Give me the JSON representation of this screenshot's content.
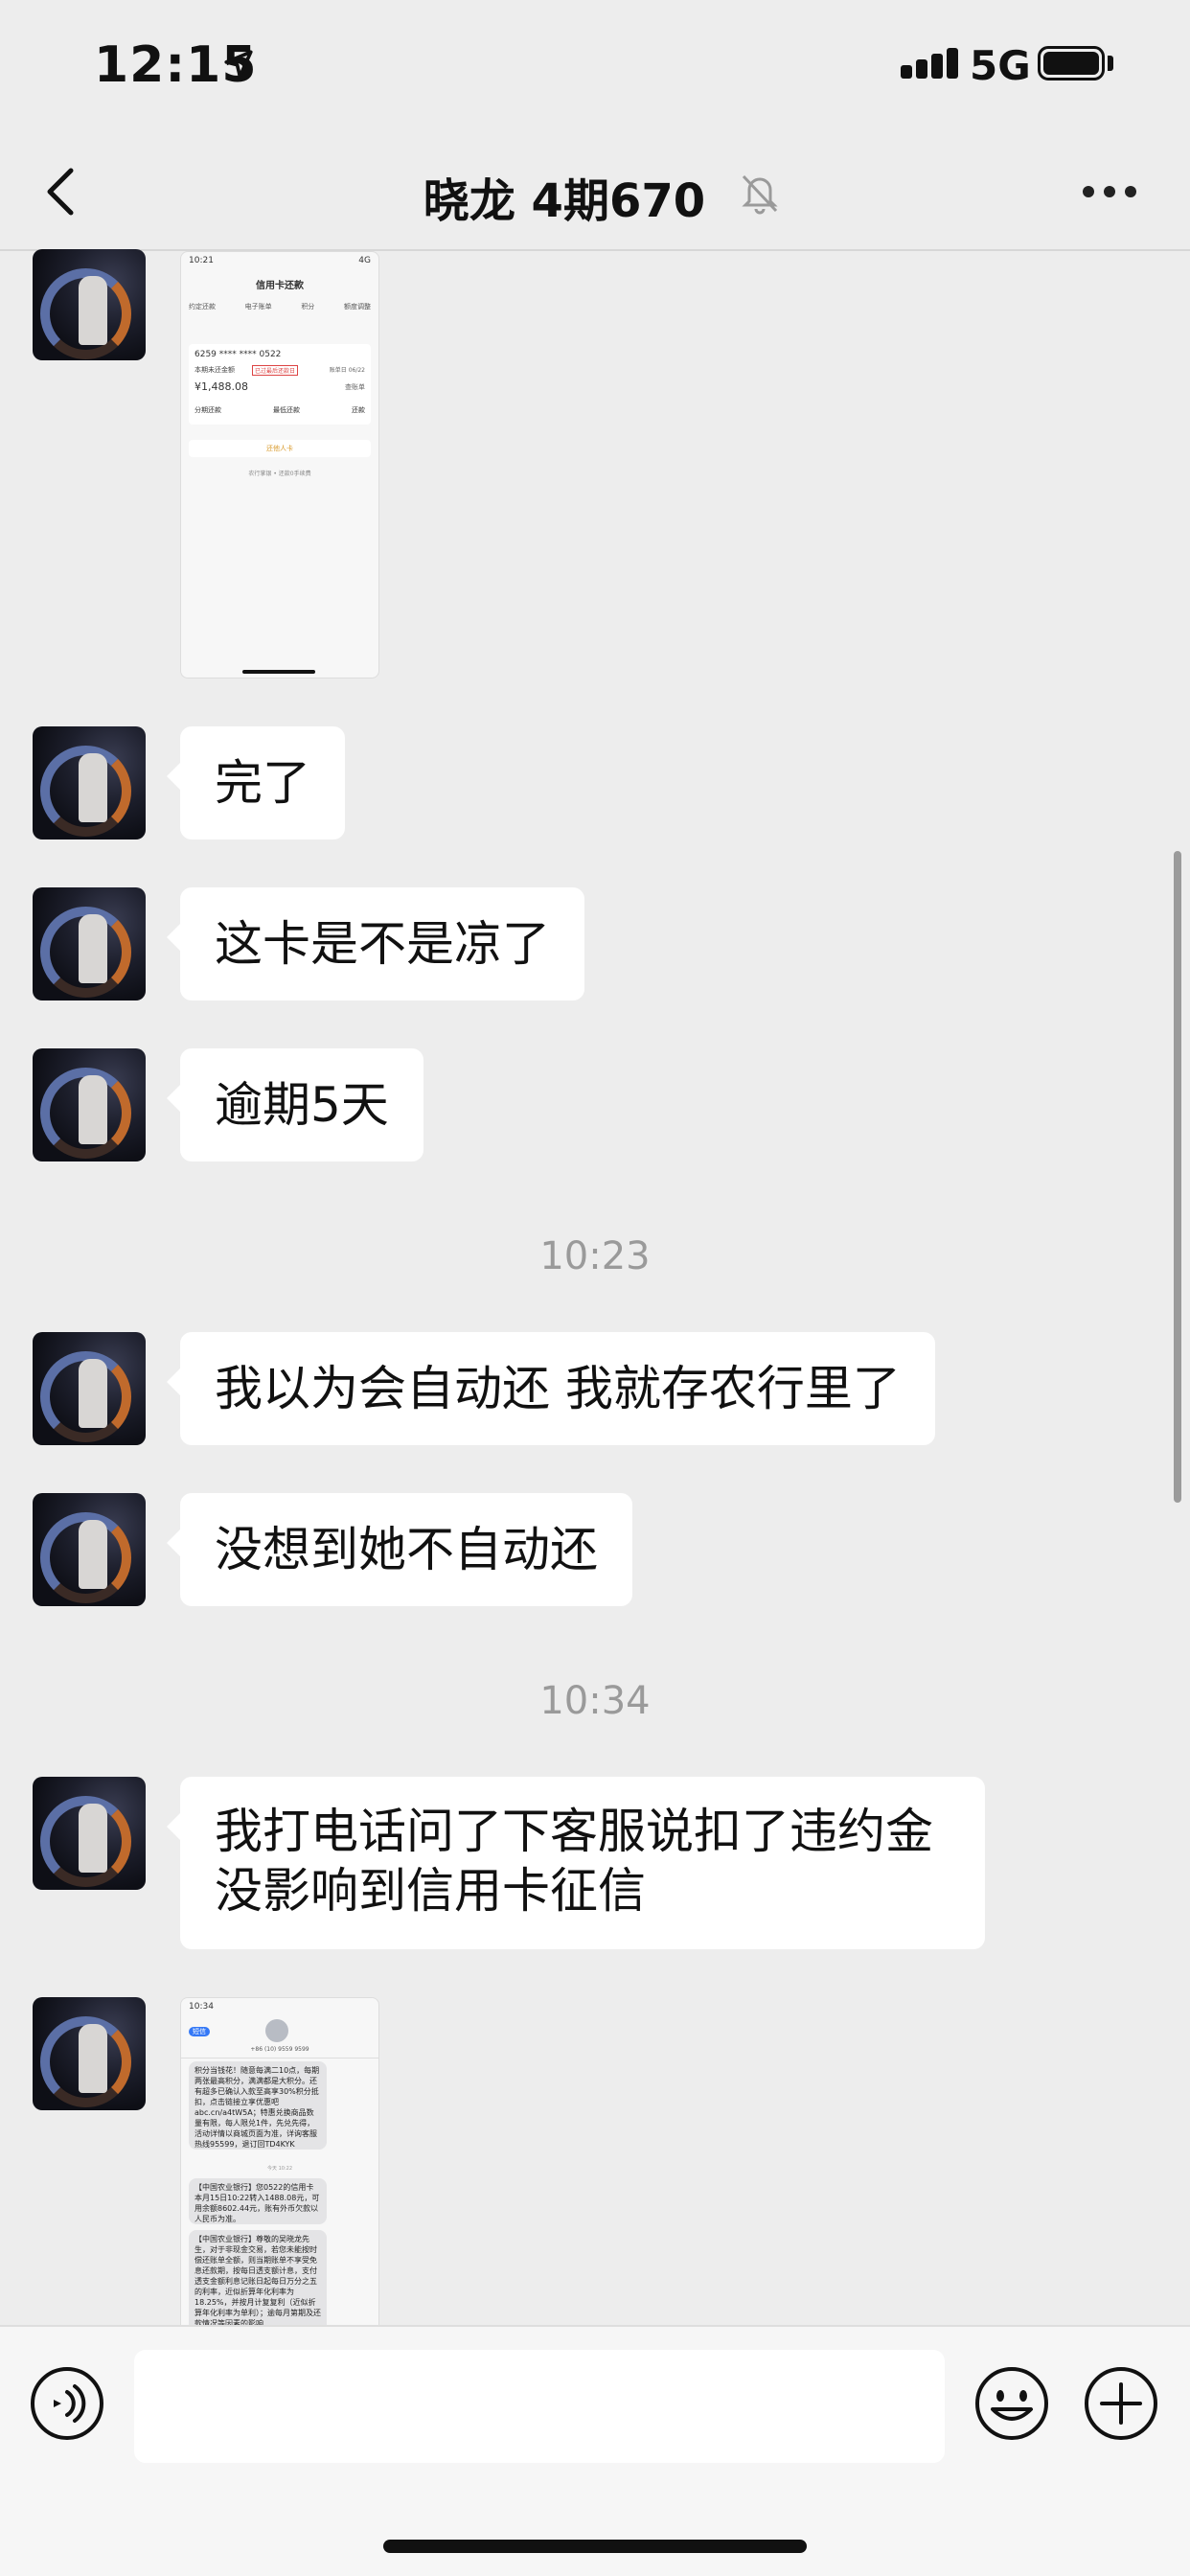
{
  "status_bar": {
    "time": "12:15",
    "network": "5G",
    "location_icon": "location-arrow-icon",
    "battery": "full"
  },
  "nav": {
    "title": "晓龙 4期670",
    "back_icon": "chevron-left-icon",
    "mute_icon": "bell-slash-icon",
    "more_icon": "ellipsis-icon"
  },
  "shot1": {
    "time": "10:21",
    "signal": "4G",
    "title": "信用卡还款",
    "tabs": [
      "约定还款",
      "电子账单",
      "积分",
      "额度调整"
    ],
    "card_number": "6259 **** **** 0522",
    "due_label": "本期未还金额",
    "due_tag": "已过最后还款日",
    "bill_date": "账单日 06/22",
    "amount": "¥1,488.08",
    "detail_link": "查账单",
    "actions": [
      "分期还款",
      "最低还款",
      "还款"
    ],
    "add_card": "还他人卡",
    "footer": "农行掌银 • 还款0手续费"
  },
  "messages": [
    {
      "text": "完了"
    },
    {
      "text": "这卡是不是凉了"
    },
    {
      "text": "逾期5天"
    },
    {
      "text": "我以为会自动还 我就存农行里了"
    },
    {
      "text": "没想到她不自动还"
    },
    {
      "text": "我打电话问了下客服说扣了违约金没影响到信用卡征信"
    }
  ],
  "timestamps": [
    "10:23",
    "10:34"
  ],
  "shot2": {
    "time": "10:34",
    "back": "短信",
    "sender": "+86 (10) 9559 9599",
    "sms": [
      "积分当钱花！随意每满二10点，每期两张最高积分，满满都是大积分。还有超多已确认入款至高享30%积分抵扣，点击链接立享优惠吧abc.cn/a4tW5A；特惠兑换商品数量有限，每人限兑1件，先兑先得，活动详情以商城页面为准，详询客服热线95599，退订回TD4KYK",
      "今天 10:22",
      "【中国农业银行】您0522的信用卡本月15日10:22转入1488.08元，可用余额8602.44元，账有外币欠款以人民币为准。",
      "【中国农业银行】尊敬的吴晓龙先生，对于非现金交易，若您未能按时偿还账单全额，则当期账单不享受免息还款期，按每日透支额计息，支付透支金额利息记账日起每日万分之五的利率，近似折算年化利率为18.25%，并按月计复复利（近似折算年化利率为单利）；逾每月第期及还款情况等因素的影响……"
    ]
  },
  "input_bar": {
    "voice_icon": "voice-wave-icon",
    "emoji_icon": "smiley-icon",
    "plus_icon": "plus-circle-icon",
    "input_value": ""
  }
}
